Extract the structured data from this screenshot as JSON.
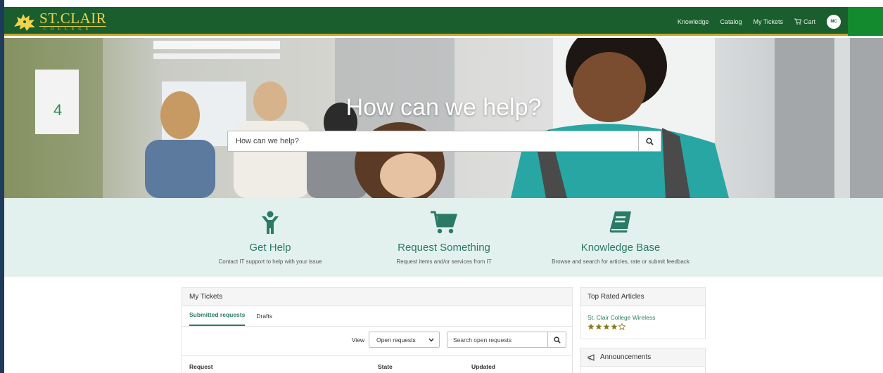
{
  "header": {
    "brand_name": "ST.CLAIR",
    "brand_sub": "COLLEGE",
    "nav": [
      {
        "label": "Knowledge"
      },
      {
        "label": "Catalog"
      },
      {
        "label": "My Tickets"
      },
      {
        "label": "Cart"
      }
    ],
    "avatar_initials": "MC"
  },
  "hero": {
    "title": "How can we help?",
    "search_placeholder": "How can we help?"
  },
  "features": [
    {
      "title": "Get Help",
      "desc": "Contact IT support to help with your issue",
      "icon": "person-icon"
    },
    {
      "title": "Request Something",
      "desc": "Request items and/or services from IT",
      "icon": "cart-icon"
    },
    {
      "title": "Knowledge Base",
      "desc": "Browse and search for articles, rate or submit feedback",
      "icon": "book-icon"
    }
  ],
  "tickets": {
    "title": "My Tickets",
    "tabs": [
      {
        "label": "Submitted requests"
      },
      {
        "label": "Drafts"
      }
    ],
    "view_label": "View",
    "view_selected": "Open requests",
    "search_placeholder": "Search open requests",
    "columns": [
      "Request",
      "State",
      "Updated"
    ]
  },
  "top_rated": {
    "title": "Top Rated Articles",
    "articles": [
      {
        "title": "St. Clair College Wireless",
        "rating": 4,
        "max_rating": 5
      }
    ]
  },
  "announcements": {
    "title": "Announcements"
  },
  "colors": {
    "header_green": "#1a5e2d",
    "accent_gold": "#c5a92a",
    "brand_teal": "#2b7a66",
    "band_bg": "#e3f1ee"
  }
}
